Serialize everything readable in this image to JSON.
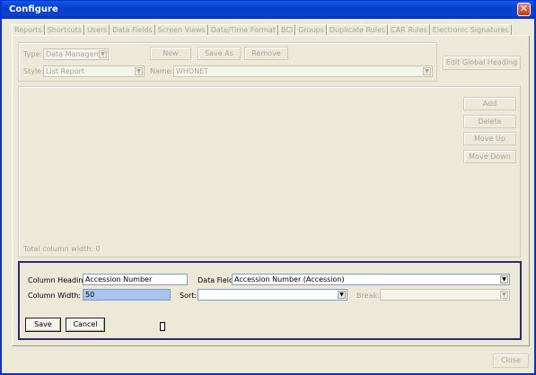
{
  "window": {
    "title": "Configure"
  },
  "tabs": [
    "Reports",
    "Shortcuts",
    "Users",
    "Data Fields",
    "Screen Views",
    "Date/Time Format",
    "BCI",
    "Groups",
    "Duplicate Rules",
    "CAR Rules",
    "Electronic Signatures"
  ],
  "report": {
    "type_label": "Type:",
    "type_value": "Data Management",
    "style_label": "Style:",
    "style_value": "List Report",
    "name_label": "Name:",
    "name_value": "WHONET",
    "new_label": "New",
    "save_as_label": "Save As",
    "remove_label": "Remove",
    "edit_global_heading_label": "Edit Global Heading"
  },
  "columns": {
    "add_label": "Add",
    "delete_label": "Delete",
    "move_up_label": "Move Up",
    "move_down_label": "Move Down",
    "total_width_text": "Total column width:  0"
  },
  "editor": {
    "column_heading_label": "Column Heading:",
    "column_heading_value": "Accession Number",
    "data_field_label": "Data Field:",
    "data_field_value": "Accession Number (Accession)",
    "column_width_label": "Column Width:",
    "column_width_value": "50",
    "sort_label": "Sort:",
    "sort_value": "",
    "break_label": "Break:",
    "break_value": "",
    "save_label": "Save",
    "cancel_label": "Cancel"
  },
  "footer": {
    "close_label": "Close"
  }
}
